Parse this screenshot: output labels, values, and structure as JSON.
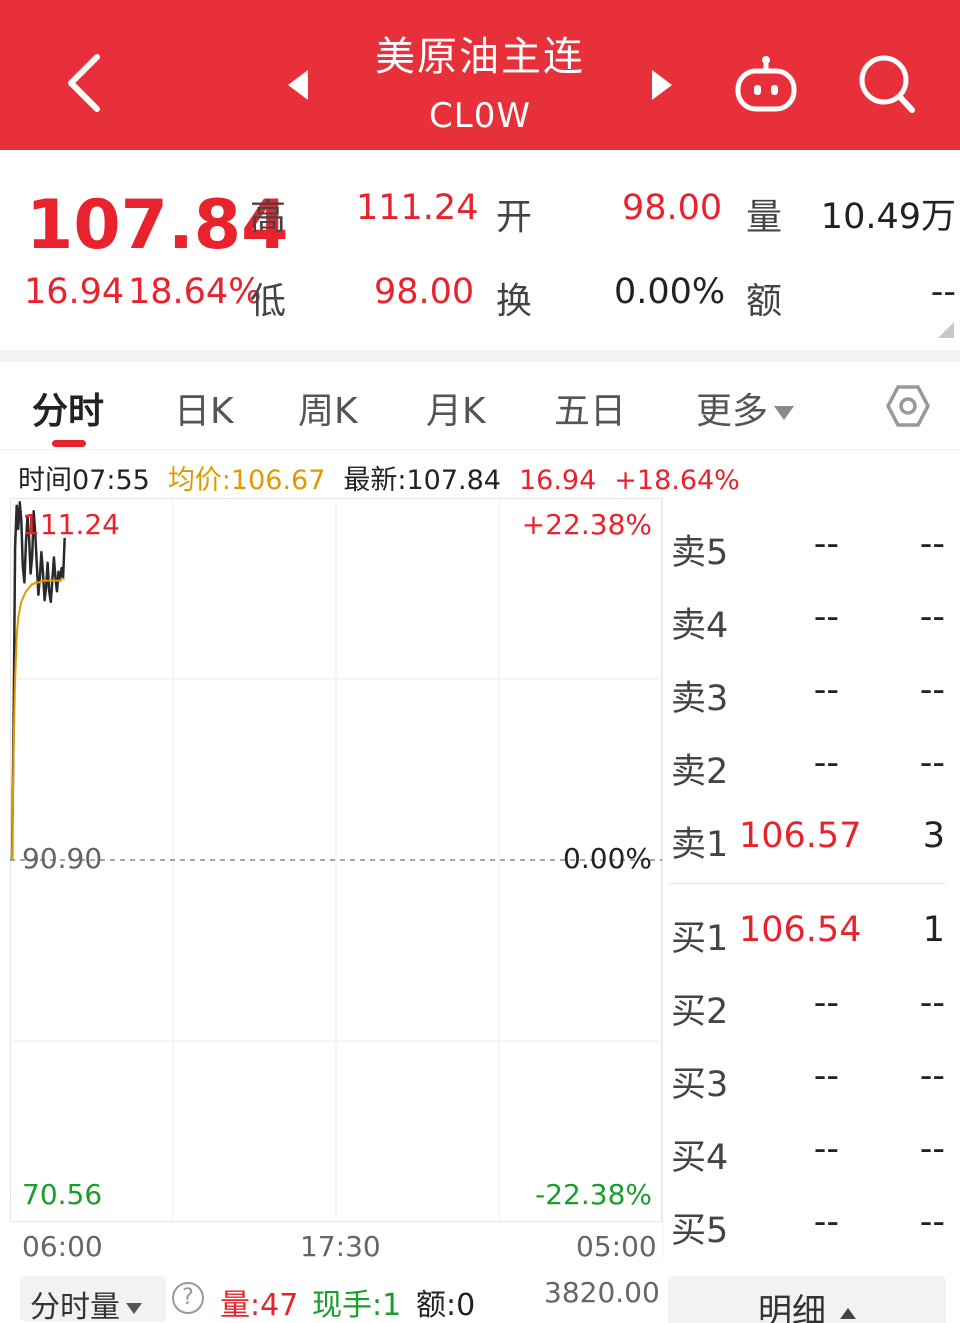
{
  "header": {
    "title": "美原油主连",
    "code": "CL0W",
    "icons": [
      "chevron-left-icon",
      "triangle-left-icon",
      "triangle-right-icon",
      "robot-icon",
      "search-icon"
    ]
  },
  "colors": {
    "header_bg": "#e8303a",
    "up": "#e8232e",
    "down": "#1a9e2b",
    "avg_line": "#e09a00"
  },
  "quote": {
    "price": "107.84",
    "change": "16.94",
    "change_pct": "18.64%",
    "high_label": "高",
    "high": "111.24",
    "open_label": "开",
    "open": "98.00",
    "volume_label": "量",
    "volume": "10.49万",
    "low_label": "低",
    "low": "98.00",
    "turnover_label": "换",
    "turnover": "0.00%",
    "amount_label": "额",
    "amount": "--"
  },
  "tabs": [
    {
      "label": "分时",
      "active": true
    },
    {
      "label": "日K"
    },
    {
      "label": "周K"
    },
    {
      "label": "月K"
    },
    {
      "label": "五日"
    },
    {
      "label": "更多"
    }
  ],
  "info": {
    "time": "时间07:55",
    "avg": "均价:106.67",
    "latest": "最新:107.84",
    "change": "16.94",
    "change_pct": "+18.64%"
  },
  "chart_data": {
    "type": "line",
    "top_price": "111.24",
    "mid_price": "90.90",
    "bottom_price": "70.56",
    "top_pct": "+22.38%",
    "mid_pct": "0.00%",
    "bottom_pct": "-22.38%",
    "x_labels": [
      "06:00",
      "17:30",
      "05:00"
    ],
    "ylim": [
      70.56,
      111.24
    ],
    "baseline": 90.9,
    "series": [
      {
        "values": [
          90.9,
          98.0,
          108.5,
          110.8,
          109.5,
          111.0,
          110.0,
          107.4,
          106.5,
          108.8,
          110.2,
          109.0,
          107.0,
          108.0,
          110.5,
          109.2,
          107.5,
          105.8,
          106.8,
          108.2,
          107.0,
          105.5,
          106.2,
          107.6,
          106.0,
          105.4,
          106.6,
          107.9,
          106.8,
          106.0,
          107.1,
          106.6,
          107.3,
          106.8,
          109.0
        ]
      },
      {
        "values": [
          90.9,
          97.0,
          101.0,
          103.5,
          104.5,
          105.0,
          105.4,
          105.6,
          105.8,
          106.0,
          106.1,
          106.2,
          106.3,
          106.4,
          106.4,
          106.5,
          106.5,
          106.5,
          106.5,
          106.6,
          106.6,
          106.6,
          106.6,
          106.6,
          106.6,
          106.6,
          106.6,
          106.6,
          106.6,
          106.6,
          106.6,
          106.6,
          106.7,
          106.7,
          106.7
        ]
      }
    ]
  },
  "order_book": {
    "asks": [
      {
        "label": "卖5",
        "price": "--",
        "vol": "--"
      },
      {
        "label": "卖4",
        "price": "--",
        "vol": "--"
      },
      {
        "label": "卖3",
        "price": "--",
        "vol": "--"
      },
      {
        "label": "卖2",
        "price": "--",
        "vol": "--"
      },
      {
        "label": "卖1",
        "price": "106.57",
        "vol": "3"
      }
    ],
    "bids": [
      {
        "label": "买1",
        "price": "106.54",
        "vol": "1"
      },
      {
        "label": "买2",
        "price": "--",
        "vol": "--"
      },
      {
        "label": "买3",
        "price": "--",
        "vol": "--"
      },
      {
        "label": "买4",
        "price": "--",
        "vol": "--"
      },
      {
        "label": "买5",
        "price": "--",
        "vol": "--"
      }
    ]
  },
  "bottom": {
    "selector": "分时量",
    "qty": "量:47",
    "hand": "现手:1",
    "amount": "额:0",
    "max": "3820.00",
    "detail": "明细"
  }
}
